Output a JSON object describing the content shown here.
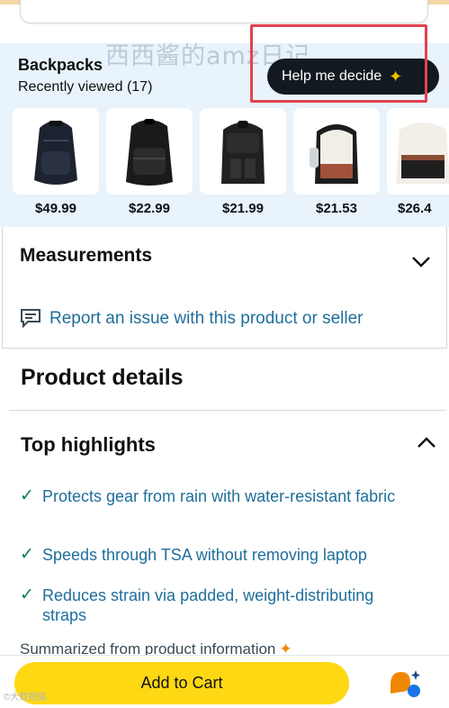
{
  "recommendations": {
    "title": "Backpacks",
    "subtitle": "Recently viewed (17)",
    "help_button": "Help me decide",
    "watermark": "西西酱的amz日记",
    "products": [
      {
        "price": "$49.99"
      },
      {
        "price": "$22.99"
      },
      {
        "price": "$21.99"
      },
      {
        "price": "$21.53"
      },
      {
        "price": "$26.4"
      }
    ]
  },
  "measurements": {
    "title": "Measurements"
  },
  "report": {
    "link_text": "Report an issue with this product or seller"
  },
  "product_details": {
    "title": "Product details"
  },
  "top_highlights": {
    "title": "Top highlights",
    "items": [
      "Protects gear from rain with water-resistant fabric",
      "Speeds through TSA without removing laptop",
      "Reduces strain via padded, weight-distributing straps"
    ],
    "summary_note": "Summarized from product information"
  },
  "bottom": {
    "add_to_cart": "Add to Cart",
    "corner_mark": "©大数据猫"
  },
  "colors": {
    "accent_blue": "#1f6e9a",
    "cart_yellow": "#ffd814",
    "check_green": "#067d62",
    "highlight_red": "#e2424f",
    "reco_bg": "#e8f3fb"
  }
}
